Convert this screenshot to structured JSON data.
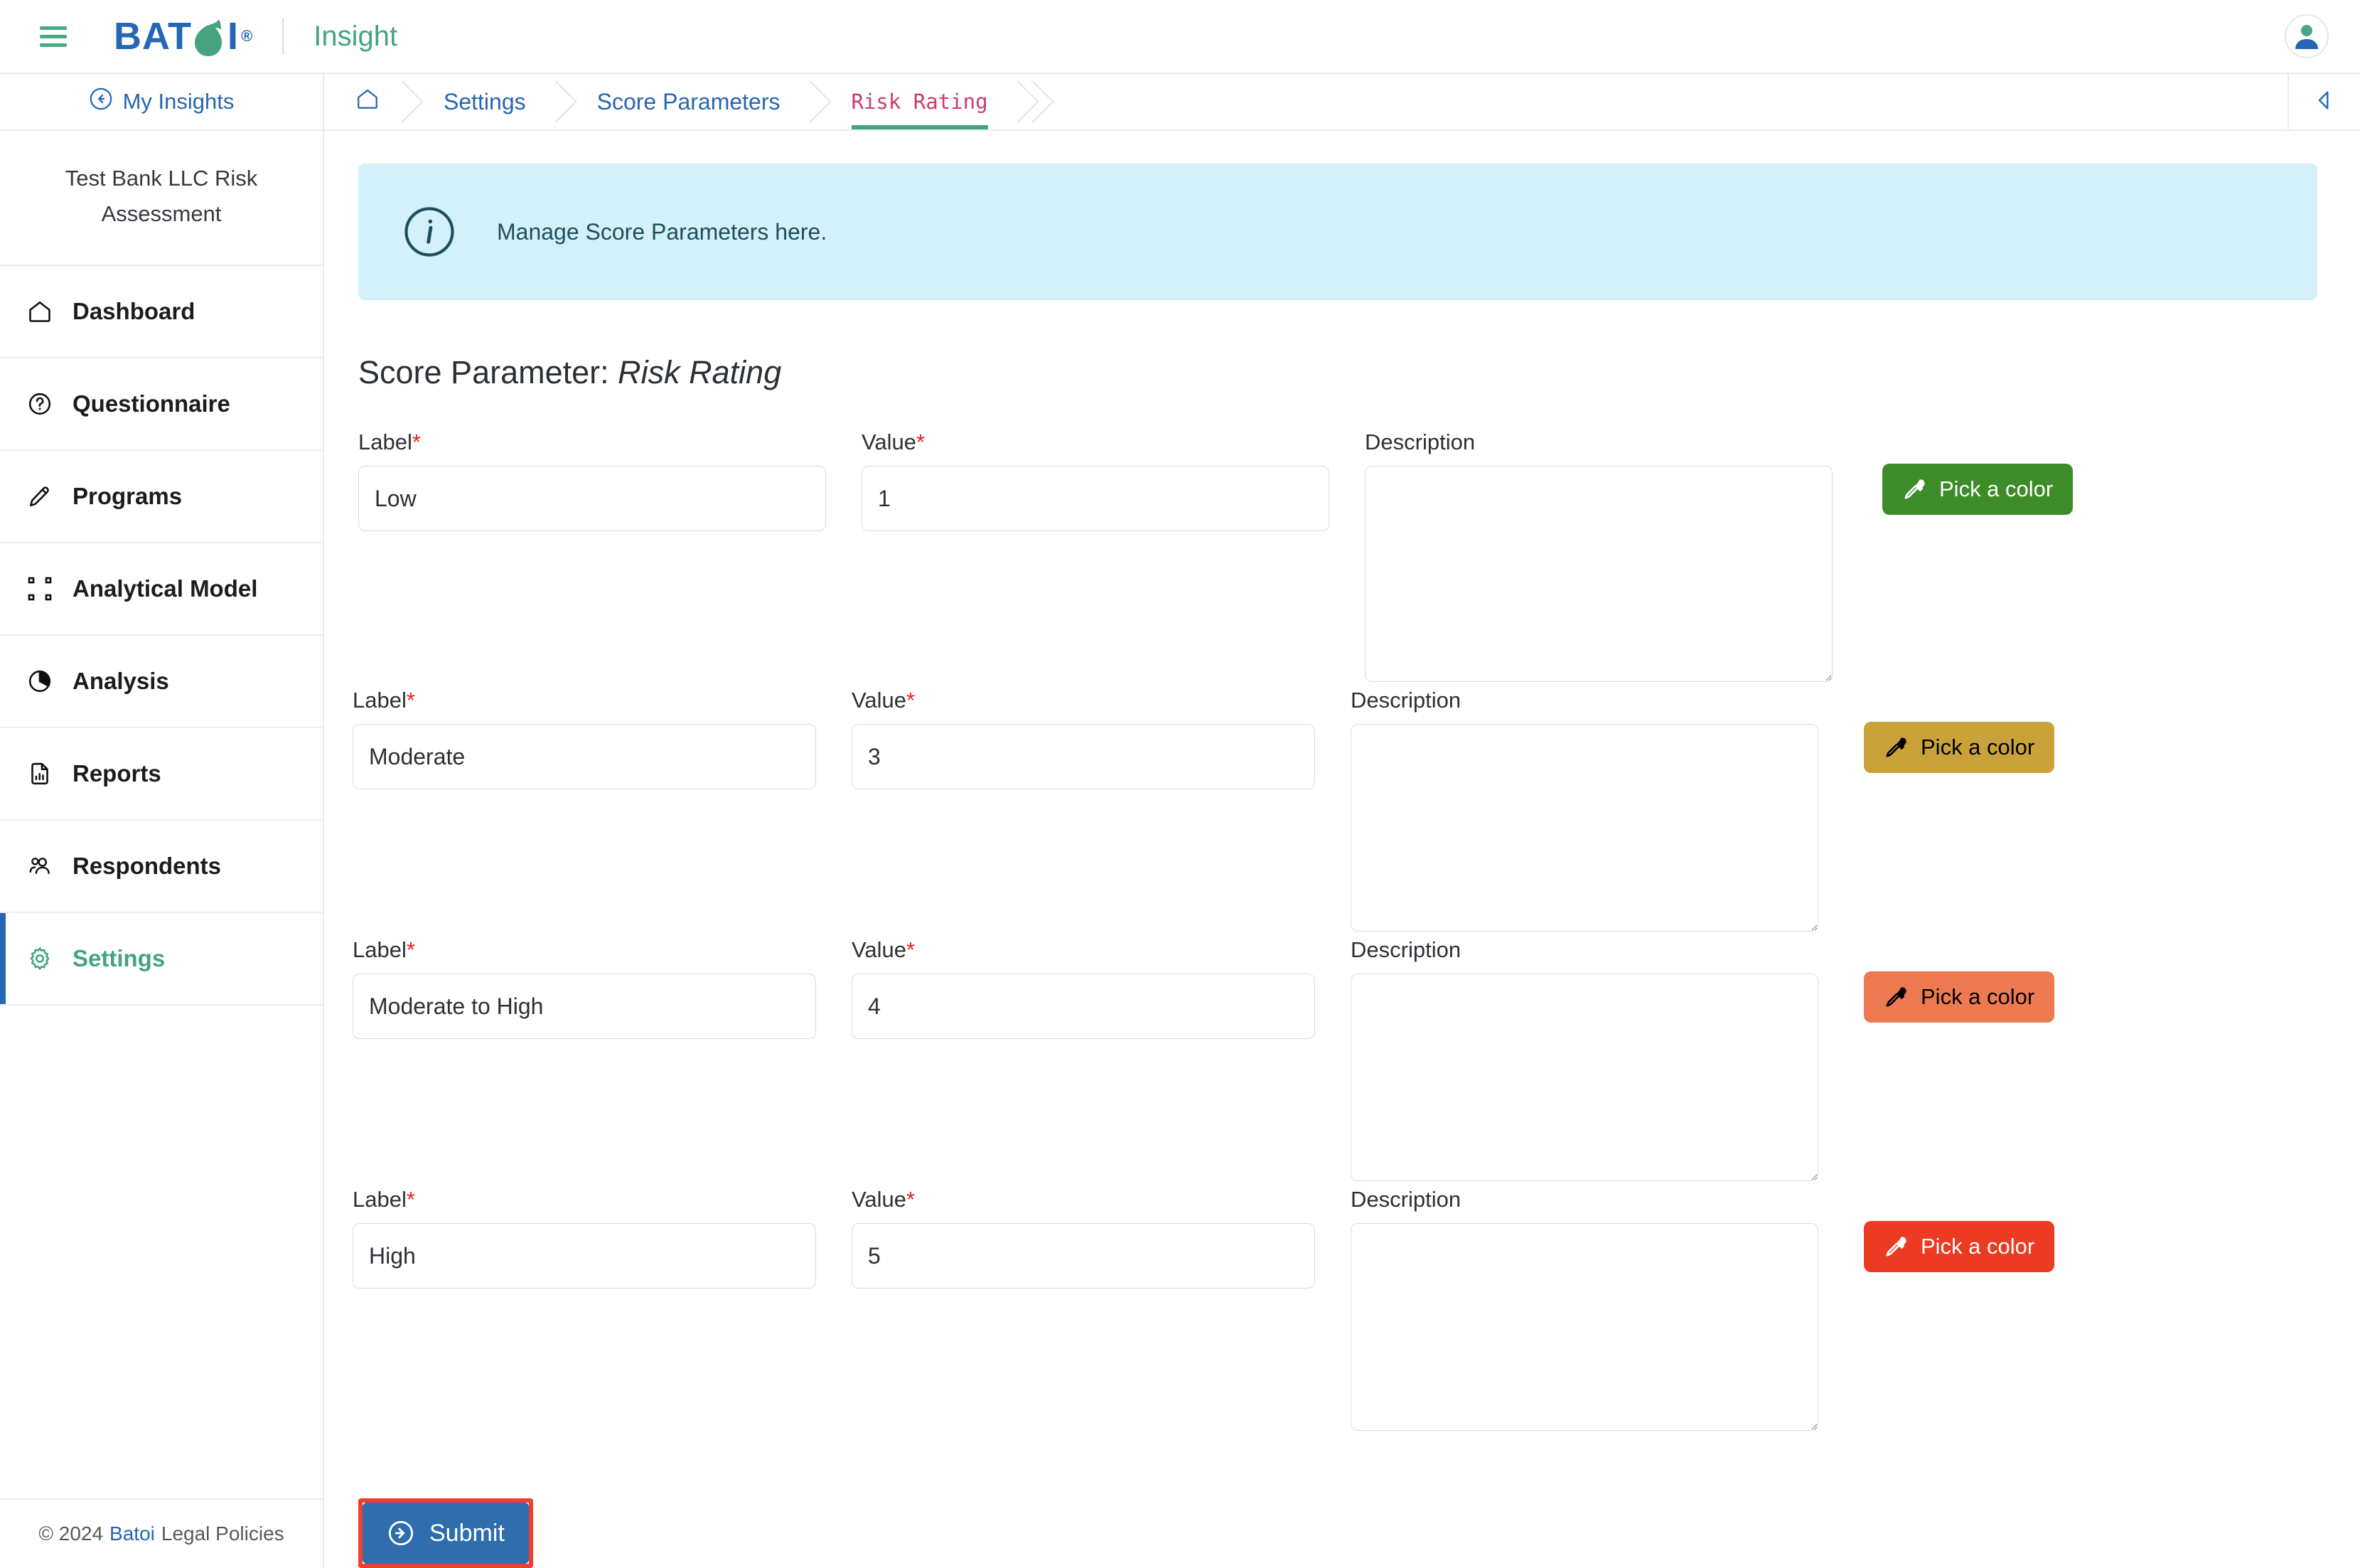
{
  "header": {
    "menu_icon": "hamburger-icon",
    "brand_name": "BATOI",
    "brand_reg": "®",
    "product_name": "Insight",
    "avatar_icon": "user-avatar-icon"
  },
  "sidebar": {
    "back_label": "My Insights",
    "back_icon": "arrow-left-circle-icon",
    "project_title": "Test Bank LLC Risk Assessment",
    "items": [
      {
        "label": "Dashboard",
        "icon": "home-icon",
        "active": false
      },
      {
        "label": "Questionnaire",
        "icon": "question-circle-icon",
        "active": false
      },
      {
        "label": "Programs",
        "icon": "pen-nib-icon",
        "active": false
      },
      {
        "label": "Analytical Model",
        "icon": "bounding-box-icon",
        "active": false
      },
      {
        "label": "Analysis",
        "icon": "pie-chart-icon",
        "active": false
      },
      {
        "label": "Reports",
        "icon": "file-chart-icon",
        "active": false
      },
      {
        "label": "Respondents",
        "icon": "people-icon",
        "active": false
      },
      {
        "label": "Settings",
        "icon": "gear-icon",
        "active": true
      }
    ],
    "footer": {
      "copyright": "© 2024",
      "brand_link": "Batoi",
      "policies": "Legal Policies"
    }
  },
  "breadcrumb": {
    "home_icon": "home-icon",
    "items": [
      {
        "label": "Settings",
        "current": false
      },
      {
        "label": "Score Parameters",
        "current": false
      },
      {
        "label": "Risk Rating",
        "current": true
      }
    ],
    "collapse_icon": "caret-left-icon"
  },
  "alert": {
    "icon": "info-circle-icon",
    "message": "Manage Score Parameters here."
  },
  "page": {
    "title_prefix": "Score Parameter:",
    "title_value": "Risk Rating"
  },
  "form": {
    "label_field_label": "Label",
    "value_field_label": "Value",
    "description_field_label": "Description",
    "required_mark": "*",
    "pick_color_label": "Pick a color",
    "pick_color_icon": "eyedropper-icon",
    "label_placeholder": "",
    "value_placeholder": "",
    "description_placeholder": "",
    "rows": [
      {
        "label": "Low",
        "value": "1",
        "description": "",
        "color": "#3e8b29",
        "text_color": "#ffffff"
      },
      {
        "label": "Moderate",
        "value": "3",
        "description": "",
        "color": "#c9a33a",
        "text_color": "#000000"
      },
      {
        "label": "Moderate to High",
        "value": "4",
        "description": "",
        "color": "#ee7a52",
        "text_color": "#000000"
      },
      {
        "label": "High",
        "value": "5",
        "description": "",
        "color": "#ec3a23",
        "text_color": "#ffffff"
      }
    ]
  },
  "submit": {
    "label": "Submit",
    "icon": "arrow-right-circle-icon",
    "highlight_color": "#f23d32",
    "button_color": "#2f6dad"
  }
}
